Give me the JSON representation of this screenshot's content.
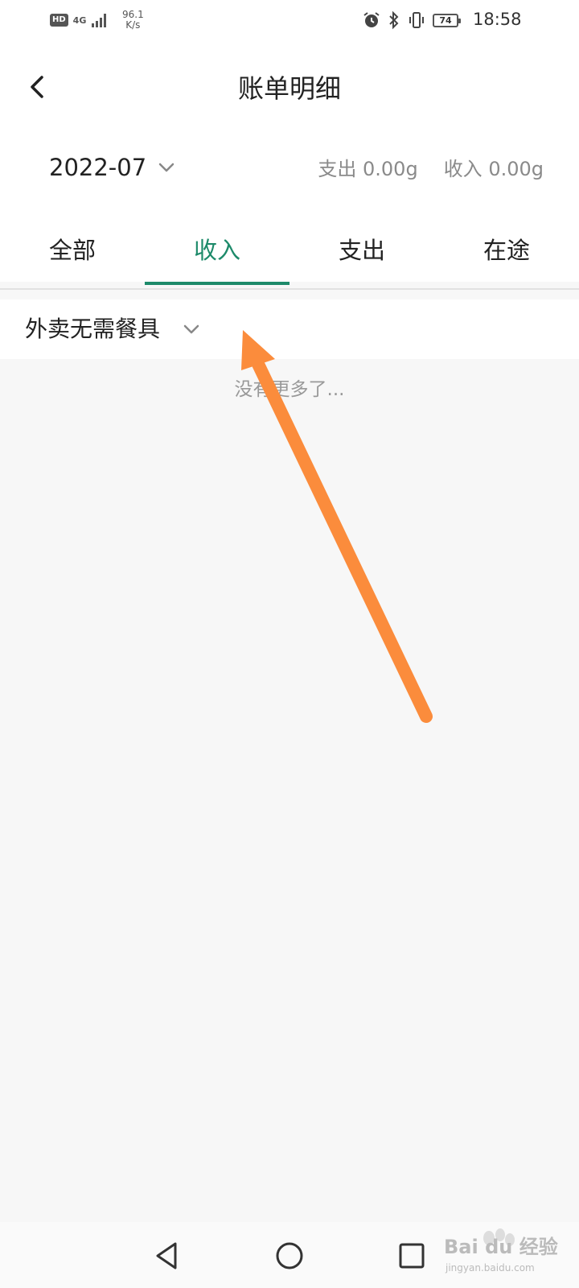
{
  "status_bar": {
    "hd_badge": "HD",
    "network": "4G",
    "speed_value": "96.1",
    "speed_unit": "K/s",
    "battery": "74",
    "time": "18:58"
  },
  "header": {
    "title": "账单明细",
    "month": "2022-07",
    "expense_summary": "支出 0.00g",
    "income_summary": "收入 0.00g"
  },
  "tabs": [
    {
      "label": "全部",
      "active": false
    },
    {
      "label": "收入",
      "active": true
    },
    {
      "label": "支出",
      "active": false
    },
    {
      "label": "在途",
      "active": false
    }
  ],
  "filter": {
    "label": "外卖无需餐具"
  },
  "list": {
    "end_text": "没有更多了..."
  },
  "watermark": {
    "text": "Bai du 经验",
    "sub": "jingyan.baidu.com"
  },
  "colors": {
    "accent": "#1d8a6a",
    "annotation": "#fb8c3c"
  },
  "icons": {
    "back": "back-arrow-icon",
    "month_dropdown": "chevron-down-icon",
    "filter_dropdown": "chevron-down-icon",
    "nav_back": "triangle-back-icon",
    "nav_home": "circle-home-icon",
    "nav_recent": "square-recent-icon"
  }
}
